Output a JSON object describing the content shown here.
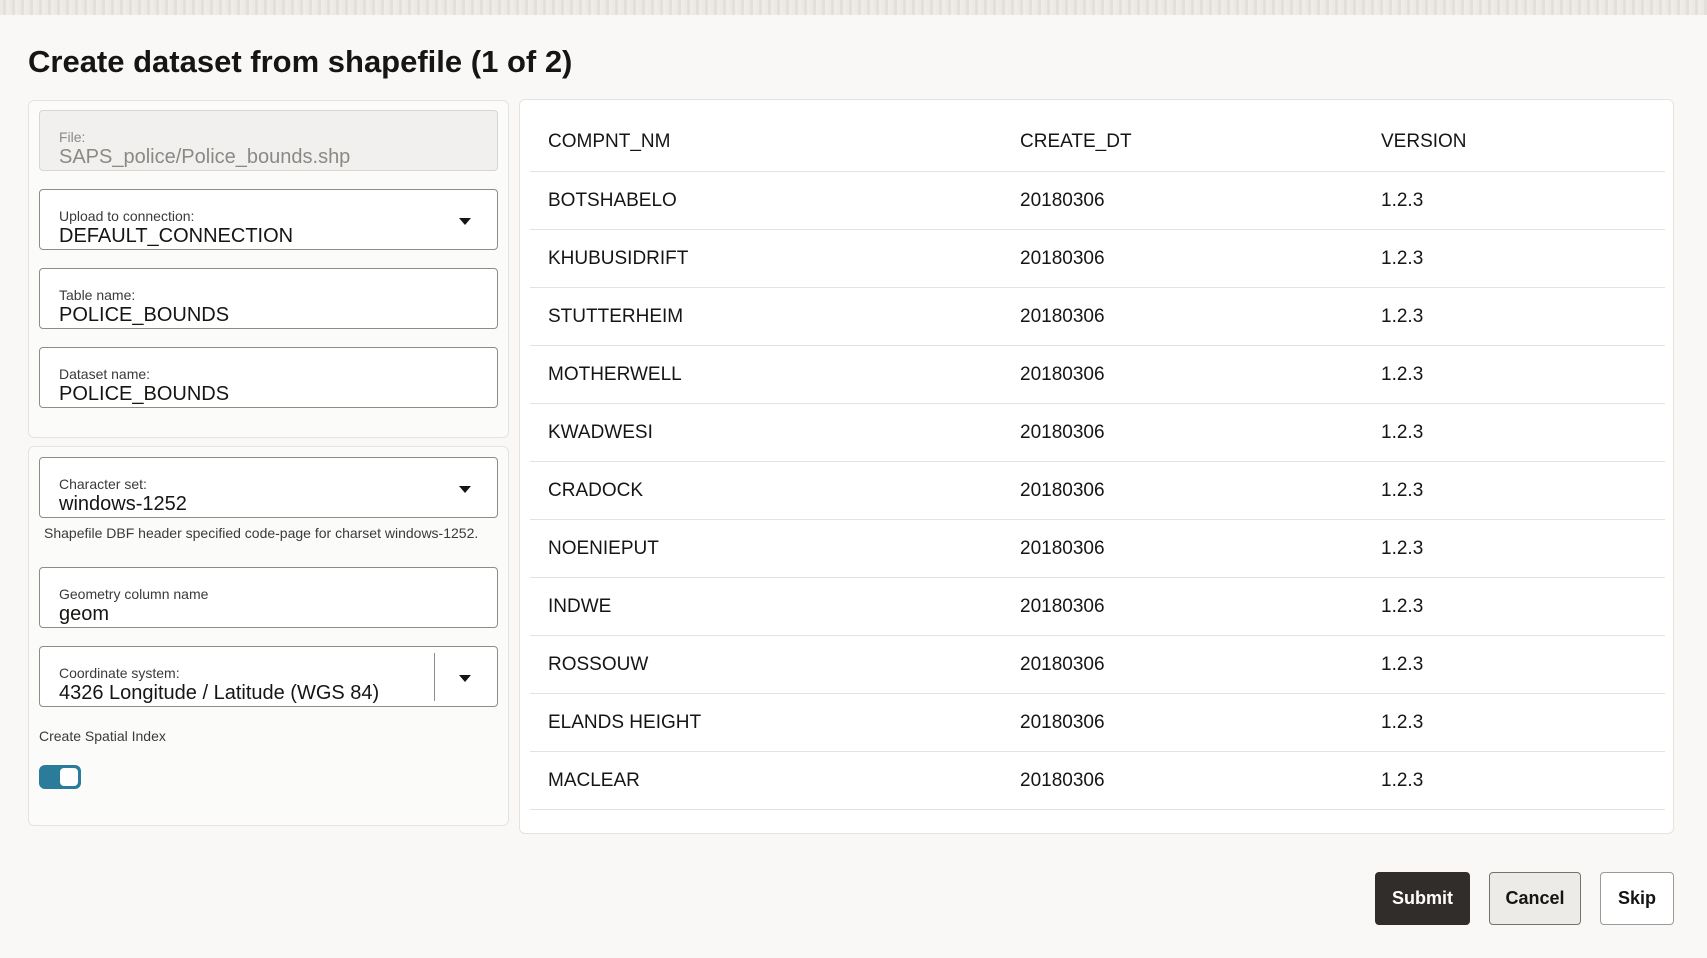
{
  "dialog": {
    "title": "Create dataset from shapefile (1 of 2)"
  },
  "form": {
    "file": {
      "label": "File:",
      "value": "SAPS_police/Police_bounds.shp"
    },
    "connection": {
      "label": "Upload to connection:",
      "value": "DEFAULT_CONNECTION"
    },
    "table_name": {
      "label": "Table name:",
      "value": "POLICE_BOUNDS"
    },
    "dataset_name": {
      "label": "Dataset name:",
      "value": "POLICE_BOUNDS"
    },
    "charset": {
      "label": "Character set:",
      "value": "windows-1252",
      "help": "Shapefile DBF header specified code-page for charset windows-1252."
    },
    "geometry_column": {
      "label": "Geometry column name",
      "value": "geom"
    },
    "coordinate_system": {
      "label": "Coordinate system:",
      "value": "4326 Longitude / Latitude (WGS 84)"
    },
    "spatial_index": {
      "label": "Create Spatial Index",
      "enabled": true
    }
  },
  "preview_table": {
    "columns": [
      "COMPNT_NM",
      "CREATE_DT",
      "VERSION"
    ],
    "rows": [
      [
        "BOTSHABELO",
        "20180306",
        "1.2.3"
      ],
      [
        "KHUBUSIDRIFT",
        "20180306",
        "1.2.3"
      ],
      [
        "STUTTERHEIM",
        "20180306",
        "1.2.3"
      ],
      [
        "MOTHERWELL",
        "20180306",
        "1.2.3"
      ],
      [
        "KWADWESI",
        "20180306",
        "1.2.3"
      ],
      [
        "CRADOCK",
        "20180306",
        "1.2.3"
      ],
      [
        "NOENIEPUT",
        "20180306",
        "1.2.3"
      ],
      [
        "INDWE",
        "20180306",
        "1.2.3"
      ],
      [
        "ROSSOUW",
        "20180306",
        "1.2.3"
      ],
      [
        "ELANDS HEIGHT",
        "20180306",
        "1.2.3"
      ],
      [
        "MACLEAR",
        "20180306",
        "1.2.3"
      ]
    ]
  },
  "buttons": {
    "submit": "Submit",
    "cancel": "Cancel",
    "skip": "Skip"
  },
  "colors": {
    "accent_toggle": "#2b7b9a",
    "primary_button": "#312d2a",
    "background": "#f9f8f6"
  }
}
